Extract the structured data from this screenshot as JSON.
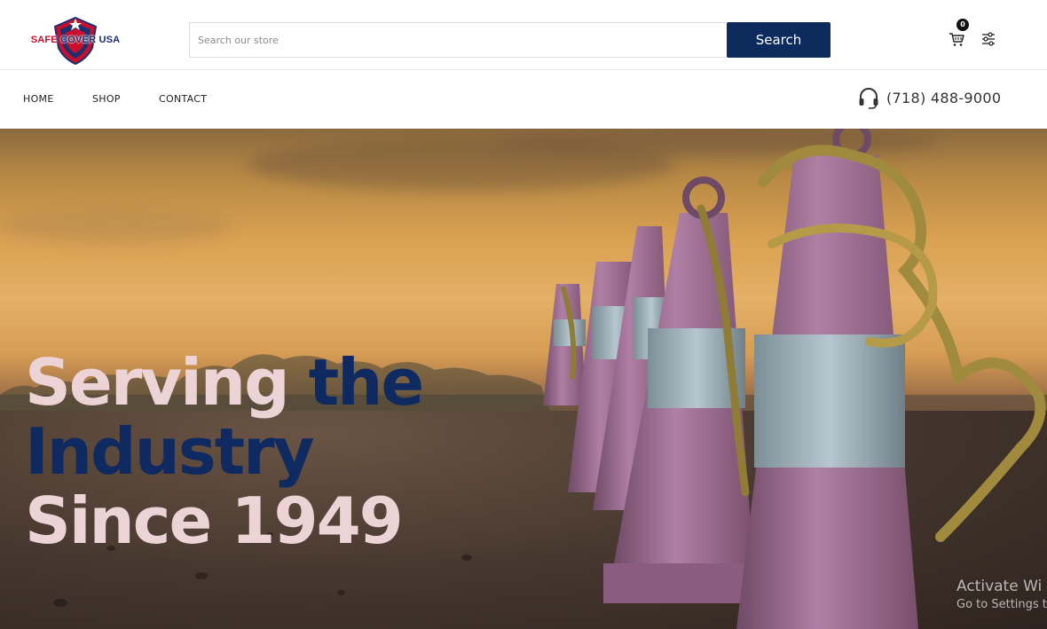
{
  "header": {
    "logo_text_left": "SAFE",
    "logo_text_mid": "COVER",
    "logo_text_right": "USA",
    "search": {
      "placeholder": "Search our store",
      "button_label": "Search"
    },
    "cart": {
      "icon": "cart-icon",
      "count": "0"
    },
    "filter_icon": "sliders-icon"
  },
  "nav": {
    "items": [
      {
        "label": "HOME"
      },
      {
        "label": "SHOP"
      },
      {
        "label": "CONTACT"
      }
    ],
    "phone": {
      "icon": "headset-icon",
      "number": "(718) 488-9000"
    }
  },
  "hero": {
    "line1_a": "Serving",
    "line1_b": "the",
    "line2": "Industry",
    "line3": "Since 1949"
  },
  "watermark": {
    "line1": "Activate Wi",
    "line2": "Go to Settings t"
  },
  "colors": {
    "brand_navy": "#0d2a5c",
    "hero_pink": "#ecd3d6",
    "logo_red": "#c8102e"
  }
}
